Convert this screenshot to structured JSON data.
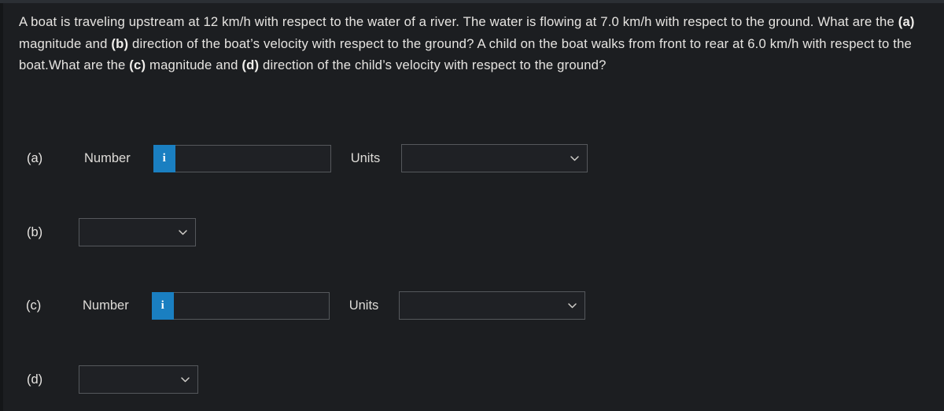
{
  "theme": {
    "background": "#1c1e21",
    "text": "#e6e4e1",
    "accent_blue": "#1a7fc1",
    "field_background": "#1f2125",
    "field_border": "#55585c"
  },
  "question": {
    "segments": [
      {
        "text": "A boat is traveling upstream at 12 km/h with respect to the water of a river. The water is flowing at 7.0 km/h with respect to the ground. What are the ",
        "bold": false
      },
      {
        "text": "(a)",
        "bold": true
      },
      {
        "text": " magnitude and ",
        "bold": false
      },
      {
        "text": "(b)",
        "bold": true
      },
      {
        "text": " direction of the boat’s velocity with respect to the ground? A child on the boat walks from front to rear at 6.0 km/h with respect to the boat.What are the ",
        "bold": false
      },
      {
        "text": "(c)",
        "bold": true
      },
      {
        "text": " magnitude and ",
        "bold": false
      },
      {
        "text": "(d)",
        "bold": true
      },
      {
        "text": " direction of the child’s velocity with respect to the ground?",
        "bold": false
      }
    ],
    "plain_text": "A boat is traveling upstream at 12 km/h with respect to the water of a river. The water is flowing at 7.0 km/h with respect to the ground. What are the (a) magnitude and (b) direction of the boat’s velocity with respect to the ground? A child on the boat walks from front to rear at 6.0 km/h with respect to the boat.What are the (c) magnitude and (d) direction of the child’s velocity with respect to the ground?"
  },
  "answers": {
    "a": {
      "part_label": "(a)",
      "number_label": "Number",
      "info_icon": "info-icon",
      "info_icon_glyph": "i",
      "number_value": "",
      "number_placeholder": "",
      "units_label": "Units",
      "units_value": "",
      "units_chevron": "chevron-down-icon"
    },
    "b": {
      "part_label": "(b)",
      "direction_value": "",
      "direction_chevron": "chevron-down-icon"
    },
    "c": {
      "part_label": "(c)",
      "number_label": "Number",
      "info_icon": "info-icon",
      "info_icon_glyph": "i",
      "number_value": "",
      "number_placeholder": "",
      "units_label": "Units",
      "units_value": "",
      "units_chevron": "chevron-down-icon"
    },
    "d": {
      "part_label": "(d)",
      "direction_value": "",
      "direction_chevron": "chevron-down-icon"
    }
  }
}
